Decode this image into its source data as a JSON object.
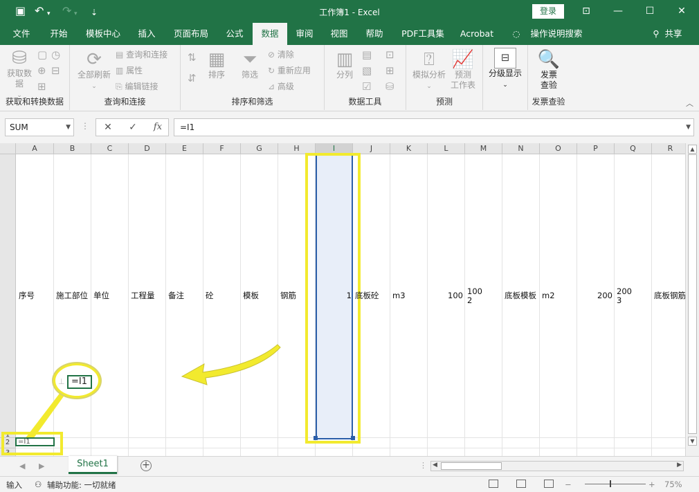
{
  "titlebar": {
    "title": "工作簿1  -  Excel",
    "login_label": "登录",
    "save_icon": "💾",
    "undo_icon": "↶",
    "redo_icon": "↷",
    "qat_icon": "⇣",
    "ribbon_display_icon": "⊡",
    "minimize_icon": "—",
    "maximize_icon": "☐",
    "close_icon": "✕"
  },
  "tabs": [
    {
      "label": "文件"
    },
    {
      "label": "开始"
    },
    {
      "label": "模板中心"
    },
    {
      "label": "插入"
    },
    {
      "label": "页面布局"
    },
    {
      "label": "公式"
    },
    {
      "label": "数据"
    },
    {
      "label": "审阅"
    },
    {
      "label": "视图"
    },
    {
      "label": "帮助"
    },
    {
      "label": "PDF工具集"
    },
    {
      "label": "Acrobat"
    },
    {
      "label": "操作说明搜索"
    },
    {
      "label": "共享"
    }
  ],
  "ribbon": {
    "get_data": {
      "label": "获取数\n据",
      "group": "获取和转换数据"
    },
    "refresh_all": {
      "label": "全部刷新"
    },
    "queries_connections": {
      "label": "查询和连接"
    },
    "properties": {
      "label": "属性"
    },
    "edit_links": {
      "label": "编辑链接"
    },
    "queries_group": "查询和连接",
    "sort": {
      "label": "排序"
    },
    "filter": {
      "label": "筛选"
    },
    "clear": {
      "label": "清除"
    },
    "reapply": {
      "label": "重新应用"
    },
    "advanced": {
      "label": "高级"
    },
    "sort_group": "排序和筛选",
    "text_to_columns": {
      "label": "分列"
    },
    "tools_group": "数据工具",
    "what_if": {
      "label": "模拟分析"
    },
    "forecast_sheet": {
      "label": "预测\n工作表"
    },
    "forecast_group": "预测",
    "outline": {
      "label": "分级显示"
    },
    "invoice": {
      "label": "发票\n查验"
    },
    "invoice_group": "发票查验",
    "collapse_icon": "︿"
  },
  "formula_bar": {
    "name_box": "SUM",
    "cancel_icon": "✕",
    "enter_icon": "✓",
    "fx_icon": "fx",
    "formula": "=I1"
  },
  "columns": [
    "A",
    "B",
    "C",
    "D",
    "E",
    "F",
    "G",
    "H",
    "I",
    "J",
    "K",
    "L",
    "M",
    "N",
    "O",
    "P",
    "Q",
    "R"
  ],
  "rows": [
    "1",
    "2",
    "3"
  ],
  "row1": [
    {
      "col": "A",
      "text": "序号"
    },
    {
      "col": "B",
      "text": "施工部位"
    },
    {
      "col": "C",
      "text": "单位"
    },
    {
      "col": "D",
      "text": "工程量"
    },
    {
      "col": "E",
      "text": "备注"
    },
    {
      "col": "F",
      "text": "砼"
    },
    {
      "col": "G",
      "text": "模板"
    },
    {
      "col": "H",
      "text": "钢筋"
    },
    {
      "col": "I",
      "text": "1"
    },
    {
      "col": "J",
      "text": "底板砼"
    },
    {
      "col": "K",
      "text": "m3"
    },
    {
      "col": "L",
      "text": "100"
    },
    {
      "col": "M",
      "text": "100\n2"
    },
    {
      "col": "N",
      "text": "底板模板"
    },
    {
      "col": "O",
      "text": "m2"
    },
    {
      "col": "P",
      "text": "200"
    },
    {
      "col": "Q",
      "text": "200\n3"
    },
    {
      "col": "R",
      "text": "底板钢筋"
    }
  ],
  "callout": {
    "text": "=I1"
  },
  "edit_cell": {
    "text": "=I1"
  },
  "sheet": {
    "tab_label": "Sheet1",
    "add_icon": "+"
  },
  "status": {
    "mode": "输入",
    "accessibility": "辅助功能: 一切就绪",
    "zoom": "75%"
  }
}
